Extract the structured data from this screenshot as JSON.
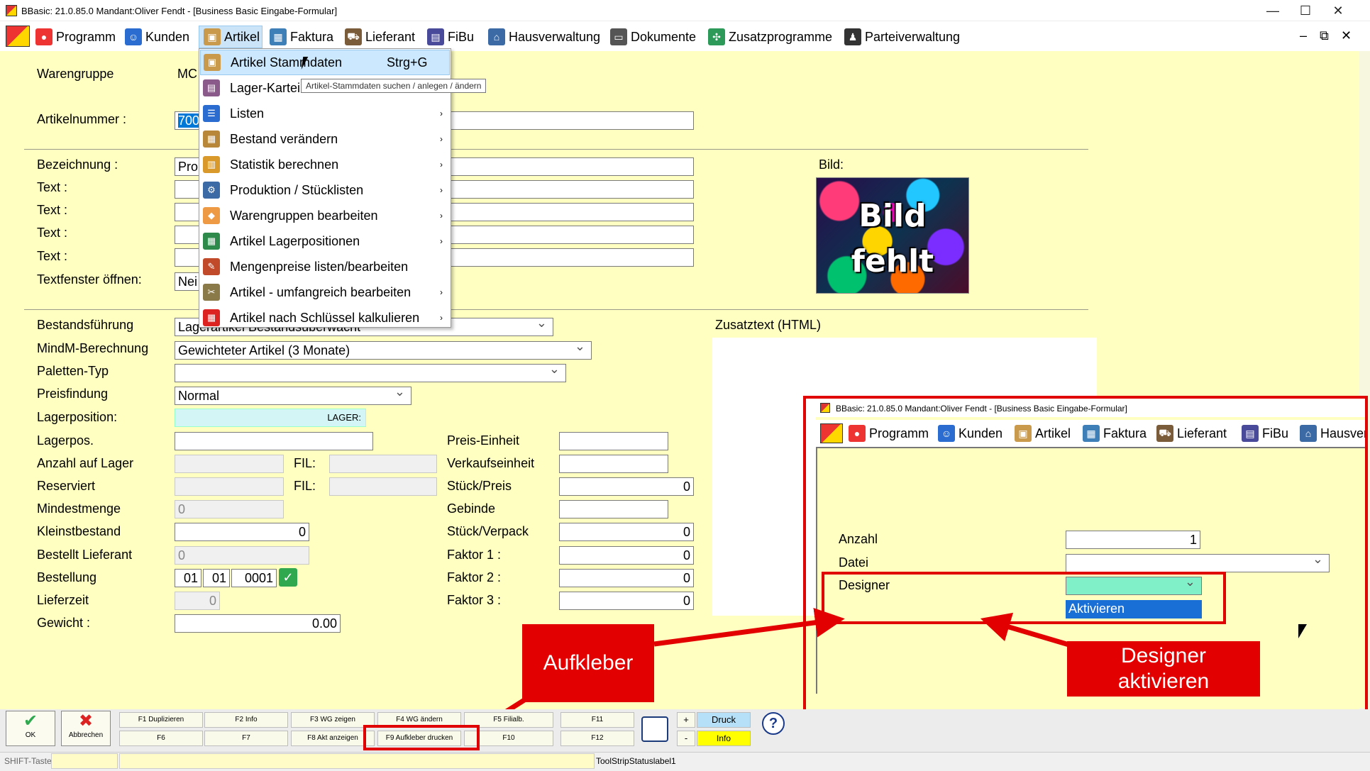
{
  "window": {
    "title": "BBasic: 21.0.85.0 Mandant:Oliver Fendt  - [Business Basic Eingabe-Formular]",
    "minimize": "—",
    "maximize": "☐",
    "close": "✕",
    "mdi_min": "–",
    "mdi_restore": "⧉",
    "mdi_close": "✕"
  },
  "menubar": {
    "items": [
      {
        "label": "Programm",
        "icon": "programm-icon",
        "color": "#e33"
      },
      {
        "label": "Kunden",
        "icon": "kunden-icon",
        "color": "#2a6ccf"
      },
      {
        "label": "Artikel",
        "icon": "artikel-icon",
        "color": "#c99a4b"
      },
      {
        "label": "Faktura",
        "icon": "faktura-icon",
        "color": "#3e7fb8"
      },
      {
        "label": "Lieferant",
        "icon": "lieferant-icon",
        "color": "#7a5b3a"
      },
      {
        "label": "FiBu",
        "icon": "fibu-icon",
        "color": "#4a4a9a"
      },
      {
        "label": "Hausverwaltung",
        "icon": "haus-icon",
        "color": "#3b6aa5"
      },
      {
        "label": "Dokumente",
        "icon": "dokumente-icon",
        "color": "#555"
      },
      {
        "label": "Zusatzprogramme",
        "icon": "zusatz-icon",
        "color": "#2d9a5a"
      },
      {
        "label": "Parteiverwaltung",
        "icon": "partei-icon",
        "color": "#333"
      }
    ]
  },
  "artikel_menu": {
    "items": [
      {
        "label": "Artikel Stammdaten",
        "shortcut": "Strg+G",
        "arrow": "",
        "color": "#c99a4b"
      },
      {
        "label": "Lager-Kartei",
        "shortcut": "",
        "arrow": "",
        "color": "#8a5b8a"
      },
      {
        "label": "Listen",
        "shortcut": "",
        "arrow": "›",
        "color": "#2a6ccf"
      },
      {
        "label": "Bestand verändern",
        "shortcut": "",
        "arrow": "›",
        "color": "#b8873a"
      },
      {
        "label": "Statistik berechnen",
        "shortcut": "",
        "arrow": "›",
        "color": "#d99a2b"
      },
      {
        "label": "Produktion / Stücklisten",
        "shortcut": "",
        "arrow": "›",
        "color": "#3b6aa5"
      },
      {
        "label": "Warengruppen bearbeiten",
        "shortcut": "",
        "arrow": "›",
        "color": "#e94"
      },
      {
        "label": "Artikel Lagerpositionen",
        "shortcut": "",
        "arrow": "›",
        "color": "#2d8a4a"
      },
      {
        "label": "Mengenpreise listen/bearbeiten",
        "shortcut": "",
        "arrow": "",
        "color": "#c04a2a"
      },
      {
        "label": "Artikel - umfangreich bearbeiten",
        "shortcut": "",
        "arrow": "›",
        "color": "#8a7a4a"
      },
      {
        "label": "Artikel nach Schlüssel kalkulieren",
        "shortcut": "",
        "arrow": "›",
        "color": "#d22"
      }
    ],
    "tooltip": "Artikel-Stammdaten suchen / anlegen / ändern"
  },
  "form": {
    "warengruppe_label": "Warengruppe",
    "warengruppe_value": "MC",
    "artikelnummer_label": "Artikelnummer :",
    "artikelnummer_value": "700",
    "bezeichnung_label": "Bezeichnung :",
    "bezeichnung_value": "Pro",
    "text_label": "Text :",
    "textfenster_label": "Textfenster öffnen:",
    "textfenster_value": "Nei",
    "bild_label": "Bild:",
    "bild_text1": "Bild",
    "bild_text2": "fehlt",
    "bestand_label": "Bestandsführung",
    "bestand_value": "Lagerartikel Bestandsüberwacht",
    "mindm_label": "MindM-Berechnung",
    "mindm_value": "Gewichteter Artikel (3 Monate)",
    "paletten_label": "Paletten-Typ",
    "paletten_value": "",
    "preisfindung_label": "Preisfindung",
    "preisfindung_value": "Normal",
    "lagerposition_label": "Lagerposition:",
    "lagerposition_value": "LAGER:",
    "lagerpos_label": "Lagerpos.",
    "anzahl_label": "Anzahl auf Lager",
    "reserviert_label": "Reserviert",
    "fil_label": "FIL:",
    "mindestmenge_label": "Mindestmenge",
    "mindestmenge_value": "0",
    "kleinstbestand_label": "Kleinstbestand",
    "kleinstbestand_value": "0",
    "bestellt_label": "Bestellt Lieferant",
    "bestellt_value": "0",
    "bestellung_label": "Bestellung",
    "bestellung_d": "01",
    "bestellung_m": "01",
    "bestellung_n": "0001",
    "lieferzeit_label": "Lieferzeit",
    "lieferzeit_value": "0",
    "gewicht_label": "Gewicht :",
    "gewicht_value": "0.00",
    "zusatztext_label": "Zusatztext (HTML)",
    "preiseinheit_label": "Preis-Einheit",
    "verkaufseinheit_label": "Verkaufseinheit",
    "stueckpreis_label": "Stück/Preis",
    "stueckpreis_value": "0",
    "gebinde_label": "Gebinde",
    "stueckverpack_label": "Stück/Verpack",
    "stueckverpack_value": "0",
    "faktor1_label": "Faktor 1 :",
    "faktor1_value": "0",
    "faktor2_label": "Faktor 2 :",
    "faktor2_value": "0",
    "faktor3_label": "Faktor 3 :",
    "faktor3_value": "0"
  },
  "toolbar": {
    "ok": "OK",
    "abbrechen": "Abbrechen",
    "f1": "F1 Duplizieren",
    "f2": "F2 Info",
    "f3": "F3 WG zeigen",
    "f4": "F4 WG ändern",
    "f5": "F5 Filialb.",
    "f11": "F11",
    "f6": "F6",
    "f7": "F7",
    "f8": "F8 Akt anzeigen",
    "f9": "F9 Aufkleber drucken",
    "f10": "F10",
    "f12": "F12",
    "plus": "+",
    "minus": "-",
    "druck": "Druck",
    "info": "Info",
    "help": "?"
  },
  "status": {
    "shift": "SHIFT-Taste",
    "label": "ToolStripStatuslabel1"
  },
  "inset": {
    "title": "BBasic: 21.0.85.0 Mandant:Oliver Fendt  - [Business Basic Eingabe-Formular]",
    "menu": [
      "Programm",
      "Kunden",
      "Artikel",
      "Faktura",
      "Lieferant",
      "FiBu",
      "Hausver"
    ],
    "anzahl_label": "Anzahl",
    "anzahl_value": "1",
    "datei_label": "Datei",
    "designer_label": "Designer",
    "aktivieren": "Aktivieren"
  },
  "callouts": {
    "aufkleber": "Aufkleber",
    "designer_line1": "Designer",
    "designer_line2": "aktivieren"
  },
  "colors": {
    "form_bg": "#ffffc2",
    "highlight": "#cce8ff",
    "red": "#e30000"
  }
}
